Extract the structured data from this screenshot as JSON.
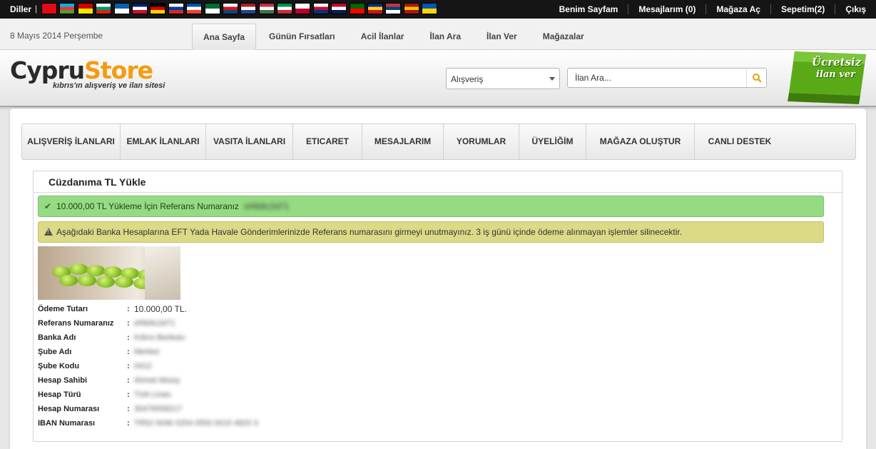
{
  "topbar": {
    "lang_label": "Diller",
    "lang_sep": "|",
    "flags": [
      {
        "name": "turkish-flag-icon",
        "c": [
          "#e30a17"
        ]
      },
      {
        "name": "azerbaijan-flag-icon",
        "c": [
          "#00b5e2",
          "#ef3340",
          "#509e2f"
        ]
      },
      {
        "name": "macedonia-flag-icon",
        "c": [
          "#d20000",
          "#ffe600"
        ]
      },
      {
        "name": "bulgaria-flag-icon",
        "c": [
          "#ffffff",
          "#00966e",
          "#d62612"
        ]
      },
      {
        "name": "greece-flag-icon",
        "c": [
          "#0d5eaf",
          "#ffffff"
        ]
      },
      {
        "name": "uk-flag-icon",
        "c": [
          "#012169",
          "#ffffff",
          "#c8102e"
        ]
      },
      {
        "name": "germany-flag-icon",
        "c": [
          "#000000",
          "#dd0000",
          "#ffce00"
        ]
      },
      {
        "name": "russia-flag-icon",
        "c": [
          "#ffffff",
          "#0039a6",
          "#d52b1e"
        ]
      },
      {
        "name": "france-flag-icon",
        "c": [
          "#0055a4",
          "#ffffff",
          "#ef4135"
        ]
      },
      {
        "name": "arabic-flag-icon",
        "c": [
          "#006c35",
          "#ffffff"
        ]
      },
      {
        "name": "czech-flag-icon",
        "c": [
          "#ffffff",
          "#d7141a",
          "#11457e"
        ]
      },
      {
        "name": "netherlands-flag-icon",
        "c": [
          "#ae1c28",
          "#ffffff",
          "#21468b"
        ]
      },
      {
        "name": "hungary-flag-icon",
        "c": [
          "#cd2a3e",
          "#ffffff",
          "#436f4d"
        ]
      },
      {
        "name": "italy-flag-icon",
        "c": [
          "#009246",
          "#ffffff",
          "#ce2b37"
        ]
      },
      {
        "name": "japan-flag-icon",
        "c": [
          "#ffffff",
          "#bc002d"
        ]
      },
      {
        "name": "korea-flag-icon",
        "c": [
          "#ffffff",
          "#c60c30",
          "#003478"
        ]
      },
      {
        "name": "norway-flag-icon",
        "c": [
          "#ba0c2f",
          "#ffffff",
          "#00205b"
        ]
      },
      {
        "name": "portugal-flag-icon",
        "c": [
          "#006600",
          "#ff0000"
        ]
      },
      {
        "name": "romania-flag-icon",
        "c": [
          "#002b7f",
          "#fcd116",
          "#ce1126"
        ]
      },
      {
        "name": "serbia-flag-icon",
        "c": [
          "#c6363c",
          "#0c4076",
          "#ffffff"
        ]
      },
      {
        "name": "spain-flag-icon",
        "c": [
          "#aa151b",
          "#f1bf00",
          "#aa151b"
        ]
      },
      {
        "name": "ukraine-flag-icon",
        "c": [
          "#0057b7",
          "#ffd700"
        ]
      }
    ],
    "nav": [
      {
        "name": "top-link-benim-sayfam",
        "label": "Benim Sayfam"
      },
      {
        "name": "top-link-mesajlarim",
        "label": "Mesajlarım (0)"
      },
      {
        "name": "top-link-magaza-ac",
        "label": "Mağaza Aç"
      },
      {
        "name": "top-link-sepetim",
        "label": "Sepetim(2)"
      },
      {
        "name": "top-link-cikis",
        "label": "Çıkış"
      }
    ]
  },
  "subbar": {
    "date": "8 Mayıs 2014 Perşembe",
    "tabs": [
      {
        "name": "tab-ana-sayfa",
        "label": "Ana Sayfa",
        "active": true
      },
      {
        "name": "tab-gunun-firsatlari",
        "label": "Günün Fırsatları"
      },
      {
        "name": "tab-acil-ilanlar",
        "label": "Acil İlanlar"
      },
      {
        "name": "tab-ilan-ara",
        "label": "İlan Ara"
      },
      {
        "name": "tab-ilan-ver",
        "label": "İlan Ver"
      },
      {
        "name": "tab-magazalar",
        "label": "Mağazalar"
      }
    ]
  },
  "header": {
    "logo_part1": "Cypru",
    "logo_part2": "Store",
    "logo_sub": "kıbrıs'ın alışveriş ve ilan sitesi",
    "category_value": "Alışveriş",
    "search_placeholder": "İlan Ara...",
    "badge_line1": "Ücretsiz",
    "badge_line2": "ilan ver",
    "colors": {
      "accent": "#f39c12",
      "badge": "#5aaa18"
    }
  },
  "menu": [
    {
      "name": "menu-alisveris-ilanlari",
      "label": "ALIŞVERİŞ İLANLARI"
    },
    {
      "name": "menu-emlak-ilanlari",
      "label": "EMLAK İLANLARI"
    },
    {
      "name": "menu-vasita-ilanlari",
      "label": "VASITA İLANLARI"
    },
    {
      "name": "menu-eticaret",
      "label": "ETICARET"
    },
    {
      "name": "menu-mesajlarim",
      "label": "MESAJLARIM"
    },
    {
      "name": "menu-yorumlar",
      "label": "YORUMLAR"
    },
    {
      "name": "menu-uyeligim",
      "label": "ÜYELİĞİM"
    },
    {
      "name": "menu-magaza-olustur",
      "label": "MAĞAZA OLUŞTUR"
    },
    {
      "name": "menu-canli-destek",
      "label": "CANLI DESTEK"
    }
  ],
  "panel": {
    "title": "Cüzdanıma TL Yükle",
    "success_text": "10.000,00 TL Yükleme İçin Referans Numaranız",
    "success_ref": "ef4b9c2d71",
    "warning_text": "Aşağıdaki Banka Hesaplarına EFT Yada Havale Gönderimlerinizde Referans numarasını girmeyi unutmayınız. 3 iş günü içinde ödeme alınmayan işlemler silinecektir.",
    "details": [
      {
        "name": "detail-odeme-tutari",
        "label": "Ödeme Tutarı",
        "value": "10.000,00 TL.",
        "blur": false
      },
      {
        "name": "detail-referans-numarasi",
        "label": "Referans Numaranız",
        "value": "ef4b9c2d71",
        "blur": true
      },
      {
        "name": "detail-banka-adi",
        "label": "Banka Adı",
        "value": "Kıbrıs Bankası",
        "blur": true
      },
      {
        "name": "detail-sube-adi",
        "label": "Şube Adı",
        "value": "Merkez",
        "blur": true
      },
      {
        "name": "detail-sube-kodu",
        "label": "Şube Kodu",
        "value": "0412",
        "blur": true
      },
      {
        "name": "detail-hesap-sahibi",
        "label": "Hesap Sahibi",
        "value": "Ahmet Aksoy",
        "blur": true
      },
      {
        "name": "detail-hesap-turu",
        "label": "Hesap Türü",
        "value": "Türk Lirası",
        "blur": true
      },
      {
        "name": "detail-hesap-numarasi",
        "label": "Hesap Numarası",
        "value": "30476558217",
        "blur": true
      },
      {
        "name": "detail-iban-numarasi",
        "label": "IBAN Numarası",
        "value": "TR52 0046 0254 0550 0015 4820 3",
        "blur": true
      }
    ]
  }
}
